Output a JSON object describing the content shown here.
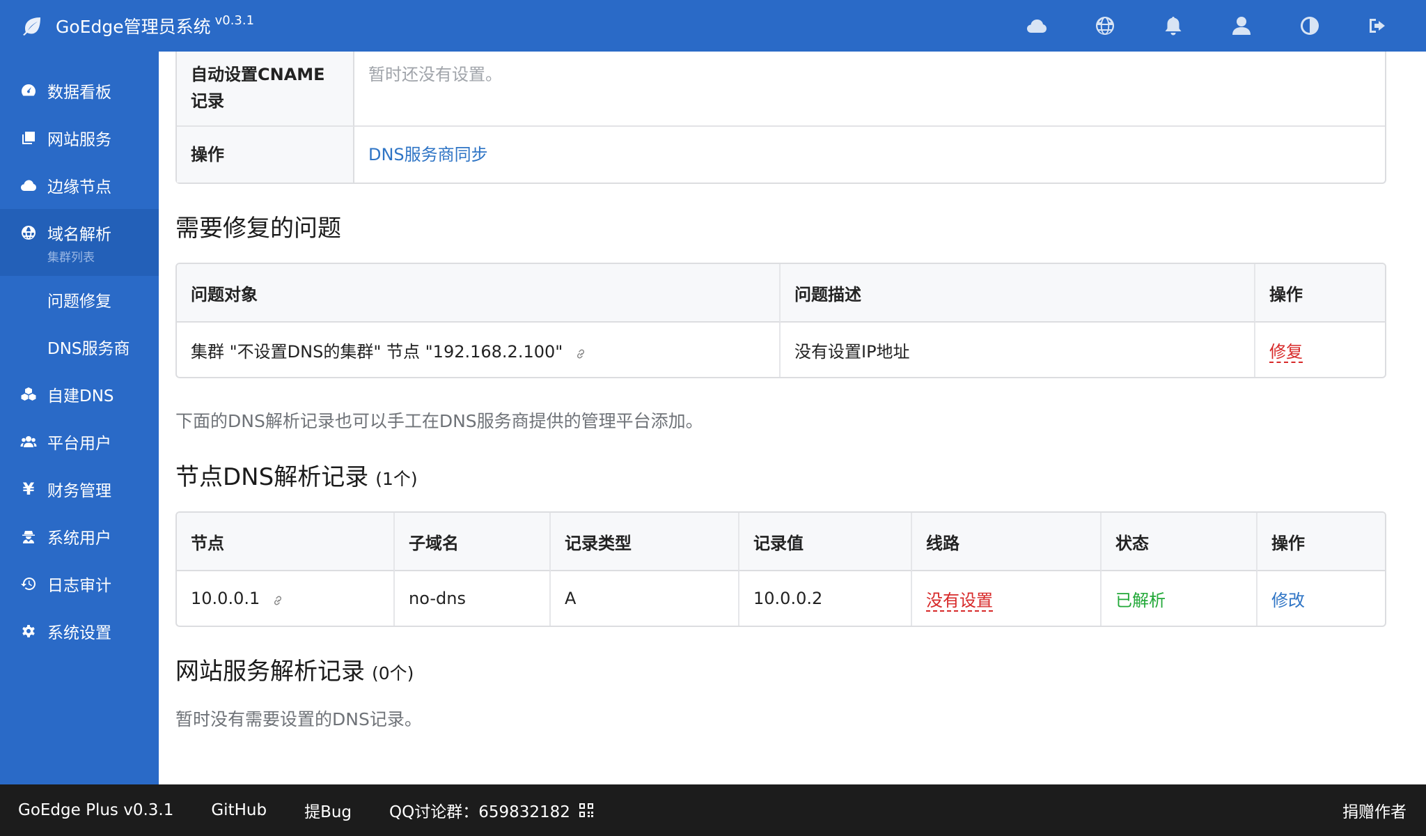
{
  "header": {
    "title": "GoEdge管理员系统",
    "version": "v0.3.1",
    "icons": [
      "cloud-icon",
      "globe-icon",
      "bell-icon",
      "user-icon",
      "theme-icon",
      "logout-icon"
    ]
  },
  "sidebar": {
    "items": [
      {
        "label": "数据看板",
        "icon": "dashboard-icon"
      },
      {
        "label": "网站服务",
        "icon": "servers-icon"
      },
      {
        "label": "边缘节点",
        "icon": "cloud-icon"
      },
      {
        "label": "域名解析",
        "icon": "globe-icon",
        "caption": "集群列表"
      },
      {
        "label": "问题修复"
      },
      {
        "label": "DNS服务商"
      },
      {
        "label": "自建DNS",
        "icon": "cubes-icon"
      },
      {
        "label": "平台用户",
        "icon": "users-icon"
      },
      {
        "label": "财务管理",
        "icon": "yen-icon",
        "glyph": "¥"
      },
      {
        "label": "系统用户",
        "icon": "user-secret-icon"
      },
      {
        "label": "日志审计",
        "icon": "history-icon"
      },
      {
        "label": "系统设置",
        "icon": "gear-icon"
      }
    ]
  },
  "info": {
    "cname_label": "自动设置CNAME记录",
    "cname_value": "暂时还没有设置。",
    "op_label": "操作",
    "op_link": "DNS服务商同步"
  },
  "issues": {
    "title": "需要修复的问题",
    "headers": [
      "问题对象",
      "问题描述",
      "操作"
    ],
    "rows": [
      {
        "object": "集群 \"不设置DNS的集群\" 节点 \"192.168.2.100\"",
        "desc": "没有设置IP地址",
        "action": "修复"
      }
    ]
  },
  "note": "下面的DNS解析记录也可以手工在DNS服务商提供的管理平台添加。",
  "node_records": {
    "title": "节点DNS解析记录",
    "count": "(1个)",
    "headers": [
      "节点",
      "子域名",
      "记录类型",
      "记录值",
      "线路",
      "状态",
      "操作"
    ],
    "rows": [
      {
        "node": "10.0.0.1",
        "sub": "no-dns",
        "type": "A",
        "value": "10.0.0.2",
        "route": "没有设置",
        "status": "已解析",
        "action": "修改"
      }
    ]
  },
  "server_records": {
    "title": "网站服务解析记录",
    "count": "(0个)",
    "empty": "暂时没有需要设置的DNS记录。"
  },
  "footer": {
    "version": "GoEdge Plus v0.3.1",
    "github": "GitHub",
    "bug": "提Bug",
    "qq": "QQ讨论群：659832182",
    "donate": "捐赠作者"
  },
  "colors": {
    "primary": "#2a6ac7",
    "sidebar_active": "#2360b8",
    "link": "#2e74c5",
    "danger": "#d72828",
    "success": "#22a838",
    "footer": "#1c1c1c"
  }
}
